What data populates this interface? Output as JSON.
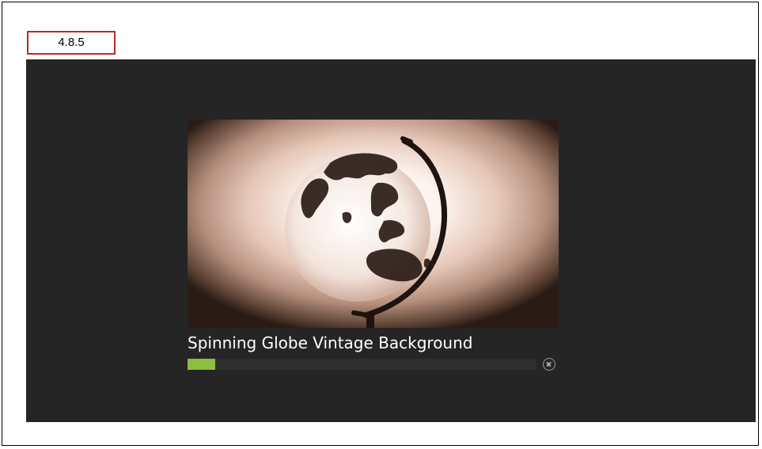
{
  "version_label": "4.8.5",
  "video": {
    "title": "Spinning Globe Vintage Background",
    "thumbnail_icon": "globe-image",
    "download_progress_percent": 8
  },
  "controls": {
    "cancel_icon": "close-circle-icon"
  },
  "colors": {
    "player_background": "#252525",
    "progress_fill": "#8cbf3f",
    "progress_track": "#2f2f2f",
    "label_border": "#c0262c"
  }
}
